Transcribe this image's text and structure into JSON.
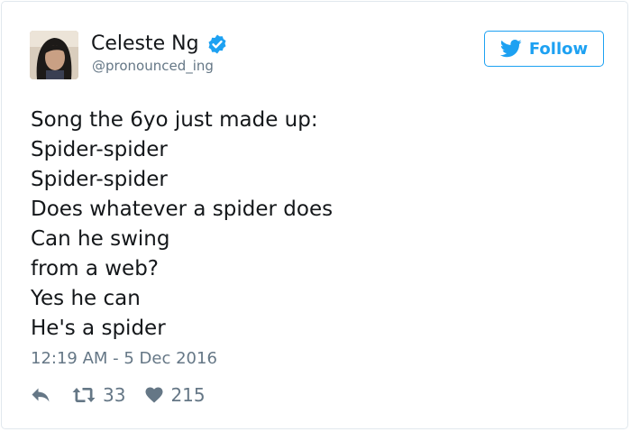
{
  "author": {
    "name": "Celeste Ng",
    "handle": "@pronounced_ing",
    "verified": true
  },
  "follow_button": {
    "label": "Follow",
    "icon": "twitter-bird-icon"
  },
  "tweet": {
    "lines": [
      "Song the 6yo just made up:",
      "Spider-spider",
      "Spider-spider",
      "Does whatever a spider does",
      "Can he swing",
      "from a web?",
      "Yes he can",
      "He's a spider"
    ],
    "timestamp": "12:19 AM - 5 Dec 2016"
  },
  "actions": {
    "reply_icon": "reply-icon",
    "retweet_icon": "retweet-icon",
    "retweet_count": "33",
    "like_icon": "heart-icon",
    "like_count": "215"
  },
  "colors": {
    "accent": "#1da1f2",
    "text": "#14171a",
    "secondary": "#657786",
    "border": "#e1e8ed"
  }
}
